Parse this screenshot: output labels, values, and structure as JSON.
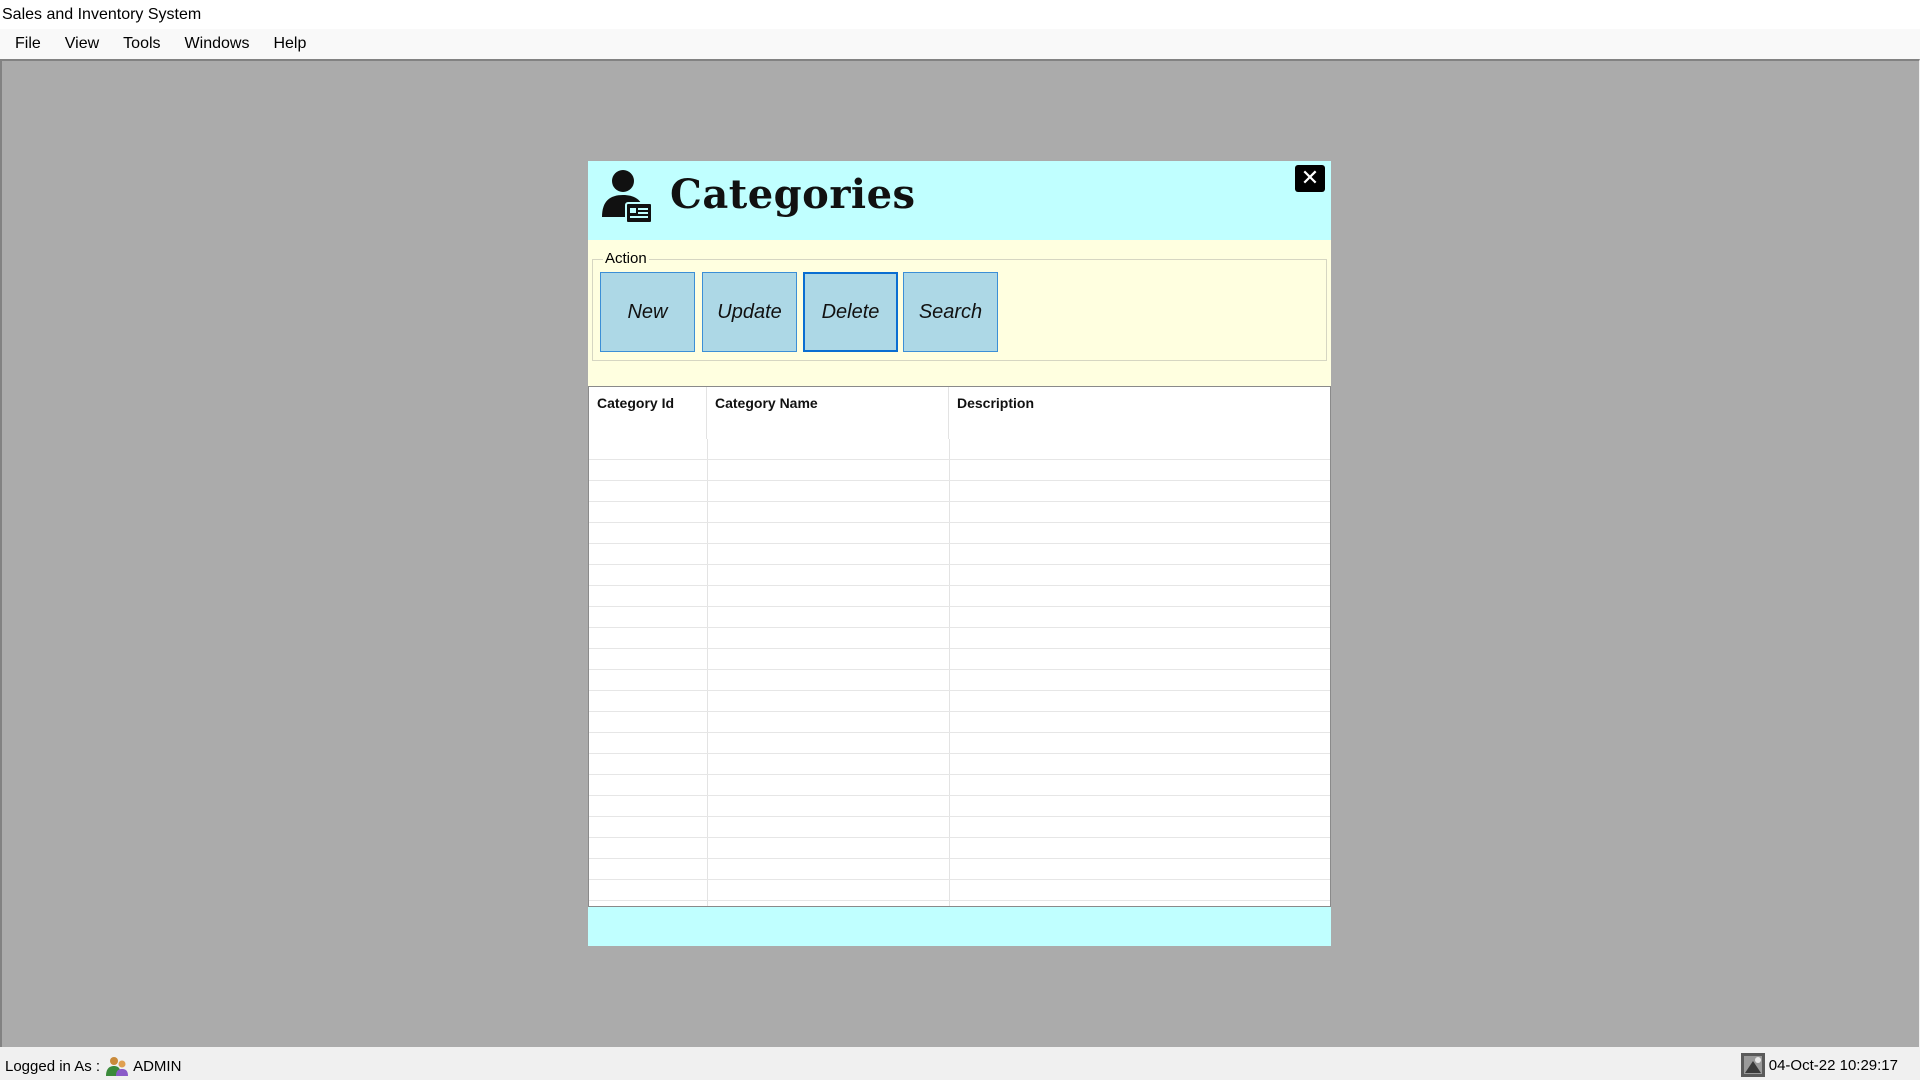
{
  "window": {
    "title": "Sales and Inventory System"
  },
  "menu": [
    {
      "label": "File"
    },
    {
      "label": "View"
    },
    {
      "label": "Tools"
    },
    {
      "label": "Windows"
    },
    {
      "label": "Help"
    }
  ],
  "dialog": {
    "title": "Categories",
    "close_glyph": "✕",
    "header_icon": "user-id-card-icon",
    "action_group_label": "Action",
    "buttons": {
      "new": "New",
      "update": "Update",
      "delete": "Delete",
      "search": "Search"
    },
    "grid": {
      "columns": [
        "Category Id",
        "Category Name",
        "Description"
      ],
      "rows": []
    }
  },
  "status": {
    "logged_in_label": "Logged in As :",
    "user_icon": "user-icon",
    "username": "ADMIN",
    "clock_icon": "clock-icon",
    "datetime": "04-Oct-22 10:29:17"
  },
  "colors": {
    "workspace": "#ababab",
    "dialog_header": "#c0ffff",
    "dialog_body": "#ffffe0",
    "button_bg": "#add8e6",
    "button_border": "#3c8fd6"
  }
}
